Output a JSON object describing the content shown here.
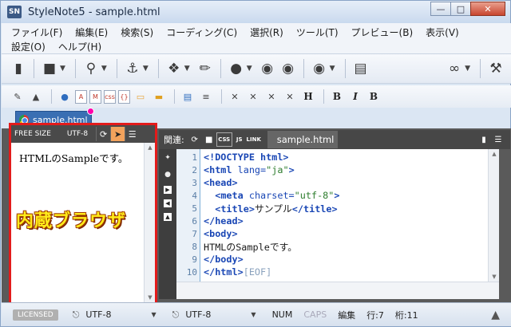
{
  "window": {
    "title": "StyleNote5 - sample.html",
    "app_icon": "SN"
  },
  "menu": {
    "row1": [
      "ファイル(F)",
      "編集(E)",
      "検索(S)",
      "コーディング(C)",
      "選択(R)",
      "ツール(T)",
      "プレビュー(B)",
      "表示(V)"
    ],
    "row2": [
      "設定(O)",
      "ヘルプ(H)"
    ]
  },
  "toolbar2": {
    "bold_labels": [
      "H",
      "B",
      "I",
      "B"
    ]
  },
  "file_tab": {
    "label": "sample.html"
  },
  "browser": {
    "size_label": "FREE SIZE",
    "encoding": "UTF-8",
    "content": "HTMLのSampleです。",
    "overlay_label": "内蔵ブラウザ"
  },
  "editor": {
    "related_label": "関連:",
    "tab_label": "sample.html",
    "css_badge": "CSS",
    "js_badge": "JS",
    "link_badge": "LINK",
    "lines": [
      {
        "n": "1",
        "parts": [
          [
            "t-tag",
            "<!DOCTYPE html>"
          ]
        ]
      },
      {
        "n": "2",
        "parts": [
          [
            "t-tag",
            "<html "
          ],
          [
            "t-attr",
            "lang="
          ],
          [
            "t-val",
            "\"ja\""
          ],
          [
            "t-tag",
            ">"
          ]
        ]
      },
      {
        "n": "3",
        "parts": [
          [
            "t-tag",
            "<head>"
          ]
        ]
      },
      {
        "n": "4",
        "parts": [
          [
            "",
            "  "
          ],
          [
            "t-tag",
            "<meta "
          ],
          [
            "t-attr",
            "charset="
          ],
          [
            "t-val",
            "\"utf-8\""
          ],
          [
            "t-tag",
            ">"
          ]
        ]
      },
      {
        "n": "5",
        "parts": [
          [
            "",
            "  "
          ],
          [
            "t-tag",
            "<title>"
          ],
          [
            "",
            "サンプル"
          ],
          [
            "t-tag",
            "</title>"
          ]
        ]
      },
      {
        "n": "6",
        "parts": [
          [
            "t-tag",
            "</head>"
          ]
        ]
      },
      {
        "n": "7",
        "parts": [
          [
            "t-tag",
            "<body>"
          ]
        ]
      },
      {
        "n": "8",
        "parts": [
          [
            "",
            "HTMLのSampleです。"
          ]
        ]
      },
      {
        "n": "9",
        "parts": [
          [
            "t-tag",
            "</body>"
          ]
        ]
      },
      {
        "n": "10",
        "parts": [
          [
            "t-tag",
            "</html>"
          ],
          [
            "t-eof",
            "[EOF]"
          ]
        ]
      }
    ]
  },
  "status": {
    "licensed": "LICENSED",
    "encoding1": "UTF-8",
    "encoding2": "UTF-8",
    "num": "NUM",
    "caps": "CAPS",
    "mode": "編集",
    "row": "行:7",
    "col": "桁:11"
  },
  "colors": {
    "highlight_border": "#e31b1b",
    "overlay_text": "#ffec1a",
    "tab_blue": "#3a6fb3"
  }
}
